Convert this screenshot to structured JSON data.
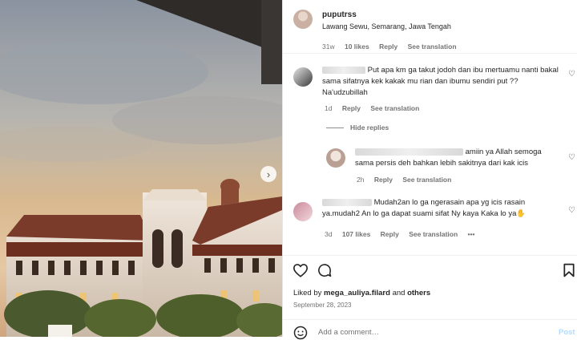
{
  "post": {
    "username": "puputrss",
    "location": "Lawang Sewu, Semarang, Jawa Tengah"
  },
  "top_meta": {
    "age": "31w",
    "likes": "10 likes",
    "reply": "Reply",
    "translate": "See translation"
  },
  "comments": [
    {
      "text": "Put apa km ga takut jodoh dan ibu mertuamu nanti bakal sama sifatnya kek kakak mu rian dan ibumu sendiri put ?? Na'udzubillah",
      "age": "1d",
      "reply": "Reply",
      "translate": "See translation"
    },
    {
      "text": "amiin ya Allah semoga sama persis deh bahkan lebih sakitnya dari kak icis",
      "age": "2h",
      "reply": "Reply",
      "translate": "See translation"
    },
    {
      "text": "Mudah2an lo ga ngerasain apa yg icis rasain ya.mudah2 An lo ga dapat suami sifat Ny kaya Kaka lo ya",
      "emoji": "✋",
      "age": "3d",
      "likes": "107 likes",
      "reply": "Reply",
      "translate": "See translation",
      "more": "•••"
    }
  ],
  "hide_replies": "Hide replies",
  "liked_by": {
    "prefix": "Liked by ",
    "user": "mega_auliya.filard",
    "mid": " and ",
    "others": "others"
  },
  "date": "September 28, 2023",
  "add_comment": {
    "placeholder": "Add a comment…",
    "post": "Post"
  },
  "icons": {
    "heart": "heart-icon",
    "comment": "comment-bubble-icon",
    "save": "bookmark-icon",
    "emoji": "emoji-icon",
    "next": "chevron-right-icon"
  },
  "colors": {
    "link_blue": "#b3dbff",
    "muted": "#737373",
    "text": "#262626"
  }
}
